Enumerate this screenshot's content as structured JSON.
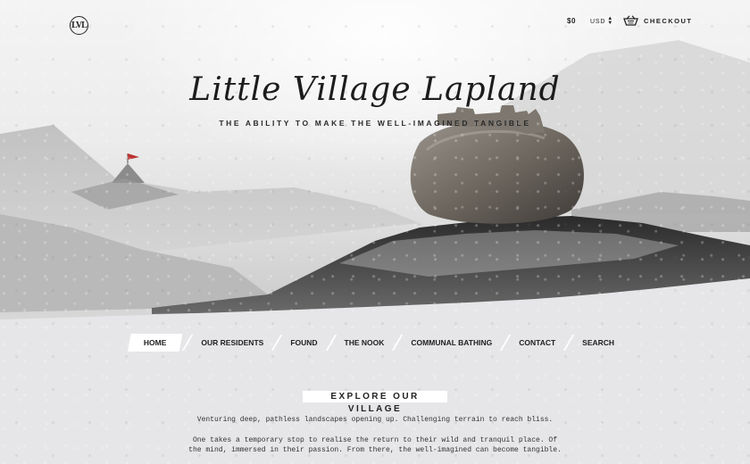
{
  "header": {
    "logo_text": "LVL",
    "cart_total": "$0",
    "currency": {
      "selected": "USD",
      "icon": "updown-arrows-icon"
    },
    "checkout_label": "CHECKOUT",
    "basket_icon": "basket-icon"
  },
  "hero": {
    "title": "Little Village Lapland",
    "tagline": "THE ABILITY TO MAKE THE WELL-IMAGINED TANGIBLE"
  },
  "nav": {
    "items": [
      {
        "label": "HOME",
        "active": true
      },
      {
        "label": "OUR RESIDENTS"
      },
      {
        "label": "FOUND"
      },
      {
        "label": "THE NOOK"
      },
      {
        "label": "COMMUNAL BATHING"
      },
      {
        "label": "CONTACT"
      },
      {
        "label": "SEARCH"
      }
    ]
  },
  "intro": {
    "heading": "EXPLORE OUR VILLAGE",
    "p1": "Venturing deep, pathless landscapes opening up. Challenging terrain to reach bliss.",
    "p2_line1": "One takes a temporary stop to realise the return to their wild and tranquil place. Of",
    "p2_line2": "the mind, immersed in their passion. From there, the well-imagined can become tangible."
  },
  "colors": {
    "accent_white": "#ffffff",
    "text": "#222222",
    "snow": "#e9e9e9"
  }
}
